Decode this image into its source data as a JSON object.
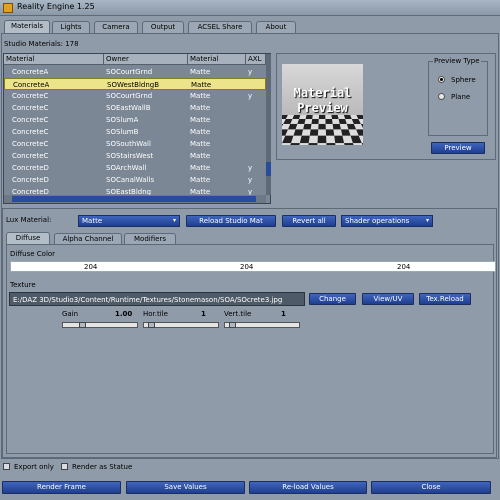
{
  "window": {
    "title": "Reality Engine 1.25"
  },
  "main_tabs": [
    "Materials",
    "Lights",
    "Camera",
    "Output",
    "ACSEL Share",
    "About"
  ],
  "studio": {
    "label": "Studio Materials: 178"
  },
  "table": {
    "headers": [
      "Material",
      "Owner",
      "Material",
      "AXL"
    ],
    "rows": [
      [
        "ConcreteA",
        "SOCourtGrnd",
        "Matte",
        "y"
      ],
      [
        "ConcreteA",
        "SOWestBldngB",
        "Matte",
        ""
      ],
      [
        "ConcreteC",
        "SOCourtGrnd",
        "Matte",
        "y"
      ],
      [
        "ConcreteC",
        "SOEastWallB",
        "Matte",
        ""
      ],
      [
        "ConcreteC",
        "SOSlumA",
        "Matte",
        ""
      ],
      [
        "ConcreteC",
        "SOSlumB",
        "Matte",
        ""
      ],
      [
        "ConcreteC",
        "SOSouthWall",
        "Matte",
        ""
      ],
      [
        "ConcreteC",
        "SOStairsWest",
        "Matte",
        ""
      ],
      [
        "ConcreteD",
        "SOArchWall",
        "Matte",
        "y"
      ],
      [
        "ConcreteD",
        "SOCanalWalls",
        "Matte",
        "y"
      ],
      [
        "ConcreteD",
        "SOEastBldng",
        "Matte",
        "y"
      ]
    ],
    "selected_row": 1
  },
  "preview": {
    "image_line1": "Material",
    "image_line2": "Preview",
    "group_label": "Preview Type",
    "options": [
      "Sphere",
      "Plane"
    ],
    "selected": "Sphere",
    "button": "Preview"
  },
  "lux": {
    "label": "Lux Material:",
    "value": "Matte",
    "reload_btn": "Reload Studio Mat",
    "revert_btn": "Revert all",
    "shader_ops": "Shader operations"
  },
  "sub_tabs": [
    "Diffuse",
    "Alpha Channel",
    "Modifiers"
  ],
  "diffuse": {
    "color_label": "Diffuse Color",
    "r": "204",
    "g": "204",
    "b": "204",
    "texture_label": "Texture",
    "texture_path": "E:/DAZ 3D/Studio3/Content/Runtime/Textures/Stonemason/SOA/SOcrete3.jpg",
    "change_btn": "Change",
    "view_btn": "View/UV",
    "reload_btn": "Tex.Reload",
    "gain_label": "Gain",
    "gain_value": "1.00",
    "hor_label": "Hor.tile",
    "hor_value": "1",
    "vert_label": "Vert.tile",
    "vert_value": "1"
  },
  "footer": {
    "export_only": "Export only",
    "render_statue": "Render as Statue",
    "buttons": [
      "Render Frame",
      "Save Values",
      "Re-load Values",
      "Close"
    ]
  },
  "colors": {
    "accent": "#2a4a9a",
    "selection": "#ece48a",
    "bg": "#8f9ba9"
  }
}
